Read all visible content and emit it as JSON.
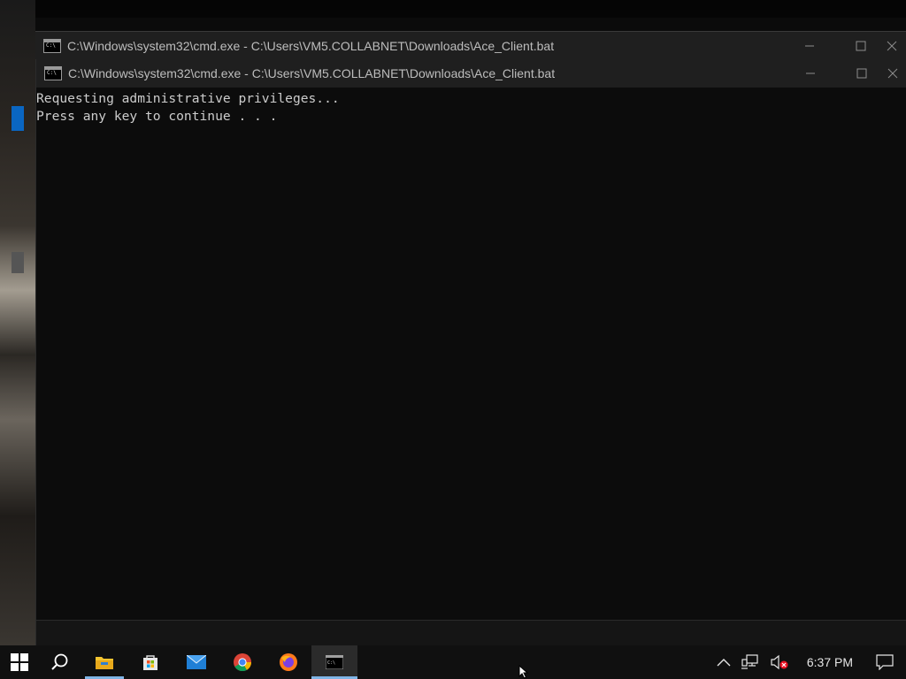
{
  "back_window": {
    "title": "C:\\Windows\\system32\\cmd.exe - C:\\Users\\VM5.COLLABNET\\Downloads\\Ace_Client.bat"
  },
  "front_window": {
    "title": "C:\\Windows\\system32\\cmd.exe - C:\\Users\\VM5.COLLABNET\\Downloads\\Ace_Client.bat",
    "console_lines": [
      "Requesting administrative privileges...",
      "Press any key to continue . . ."
    ]
  },
  "icon_glyph": "C:\\",
  "taskbar": {
    "apps": [
      {
        "name": "start-icon"
      },
      {
        "name": "search-icon"
      },
      {
        "name": "file-explorer-icon"
      },
      {
        "name": "microsoft-store-icon"
      },
      {
        "name": "mail-icon"
      },
      {
        "name": "chrome-icon"
      },
      {
        "name": "firefox-icon"
      },
      {
        "name": "command-prompt-icon"
      }
    ],
    "clock": "6:37 PM"
  },
  "colors": {
    "console_bg": "#0c0c0c",
    "console_text": "#cccccc",
    "taskbar_bg": "#101010",
    "accent": "#7fb5e6"
  }
}
